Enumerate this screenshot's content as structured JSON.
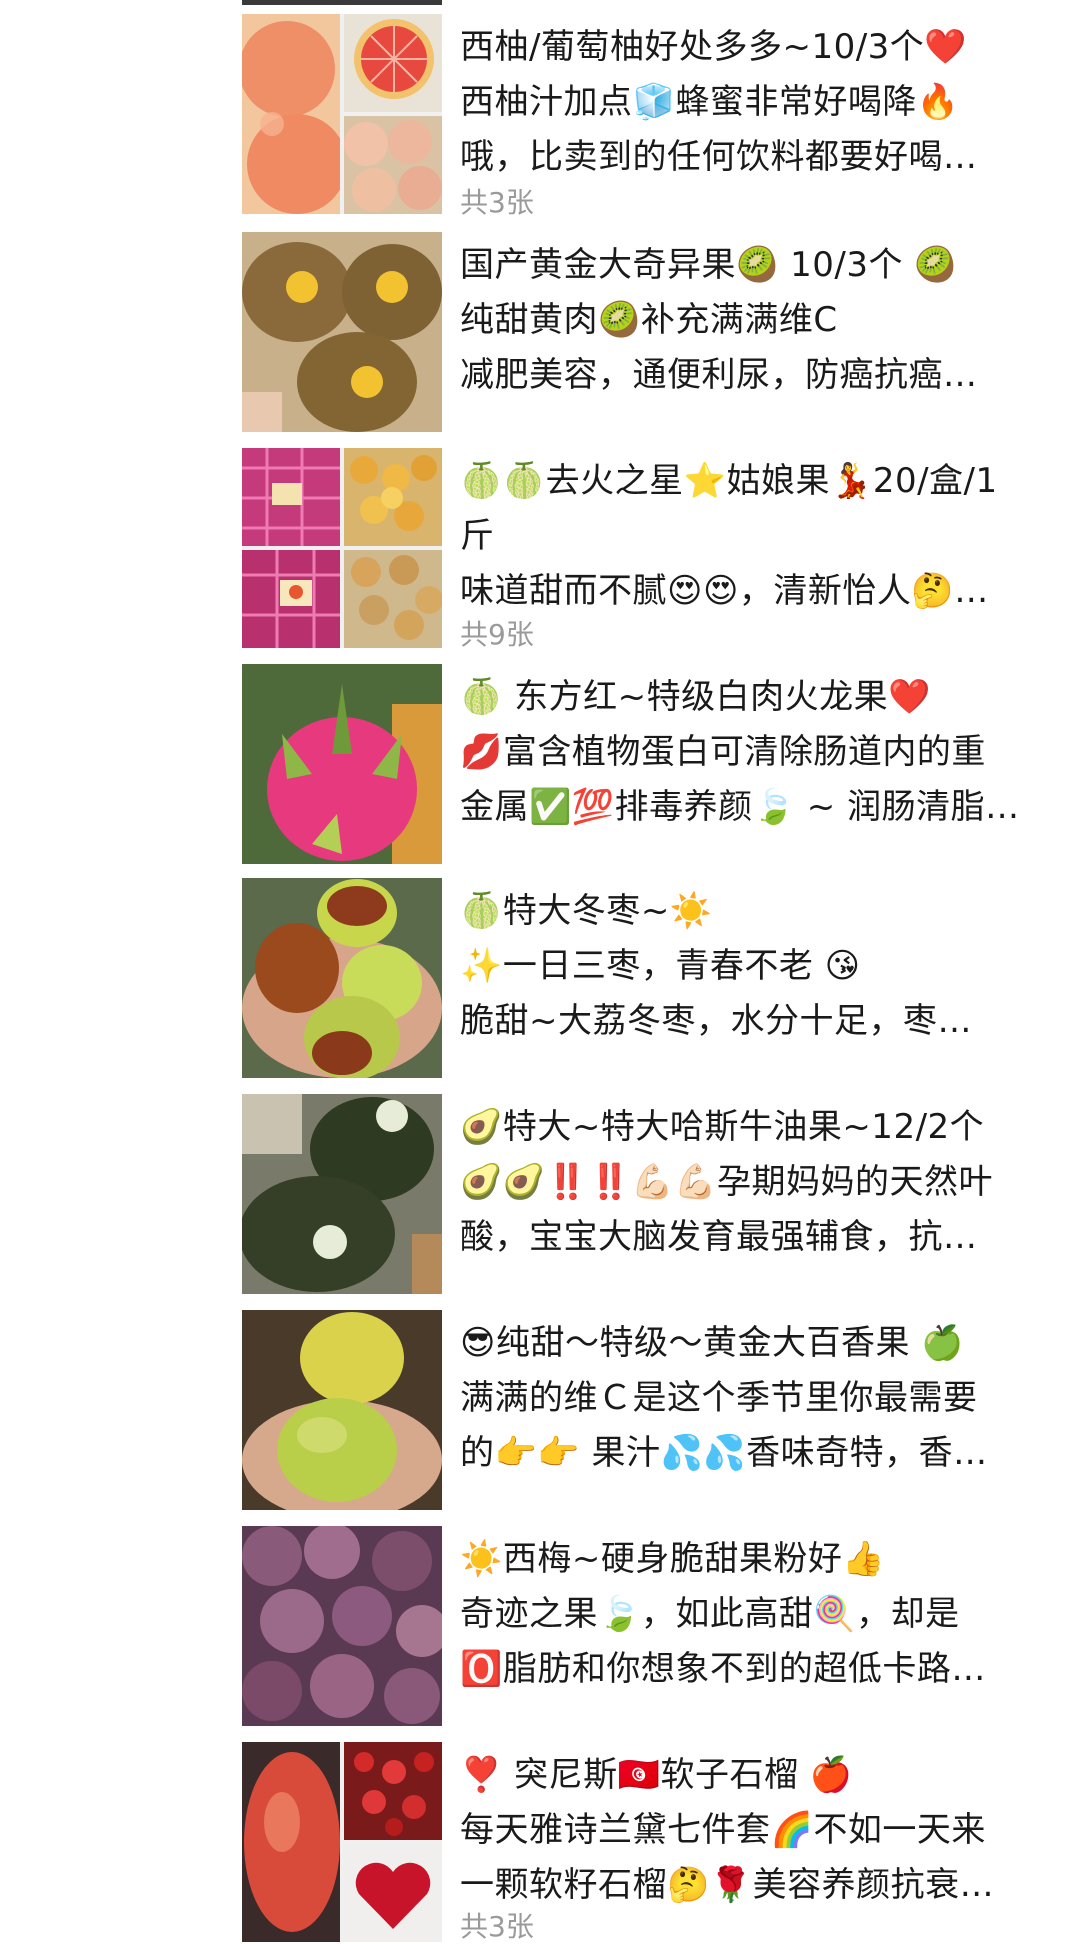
{
  "posts": [
    {
      "lines": [
        "西柚/葡萄柚好处多多~10/3个❤️",
        "西柚汁加点🧊蜂蜜非常好喝降🔥",
        "哦，比卖到的任何饮料都要好喝…"
      ],
      "count": "共3张",
      "image_icons": [
        "grapefruit-photo",
        "grapefruit-half-photo",
        "grapefruit-pile-photo"
      ]
    },
    {
      "lines": [
        "国产黄金大奇异果🥝 10/3个 🥝",
        "纯甜黄肉🥝补充满满维C",
        "减肥美容，通便利尿，防癌抗癌…"
      ],
      "count": "",
      "image_icons": [
        "kiwi-photo"
      ]
    },
    {
      "lines": [
        "🍈🍈去火之星⭐姑娘果💃20/盒/1",
        "斤",
        "味道甜而不腻😍😍，清新怡人🤔…"
      ],
      "count": "共9张",
      "image_icons": [
        "goldenberry-box-photo",
        "goldenberry-pile-photo",
        "goldenberry-box-photo-2",
        "goldenberry-husk-photo"
      ]
    },
    {
      "lines": [
        "🍈 东方红~特级白肉火龙果❤️",
        "💋富含植物蛋白可清除肠道内的重",
        "金属✅💯排毒养颜🍃 ~ 润肠清脂…"
      ],
      "count": "",
      "image_icons": [
        "dragon-fruit-photo"
      ]
    },
    {
      "lines": [
        "🍈特大冬枣~☀️",
        "✨一日三枣，青春不老 😘",
        "脆甜~大荔冬枣，水分十足，枣…"
      ],
      "count": "",
      "image_icons": [
        "jujube-photo"
      ]
    },
    {
      "lines": [
        "🥑特大~特大哈斯牛油果~12/2个",
        "🥑🥑‼️‼️💪🏻💪🏻孕期妈妈的天然叶",
        "酸，宝宝大脑发育最强辅食，抗…"
      ],
      "count": "",
      "image_icons": [
        "avocado-photo"
      ]
    },
    {
      "lines": [
        "😎纯甜～特级～黄金大百香果 🍏",
        "满满的维Ｃ是这个季节里你最需要",
        "的👉👉 果汁💦💦香味奇特，香…"
      ],
      "count": "",
      "image_icons": [
        "passion-fruit-photo"
      ]
    },
    {
      "lines": [
        "☀️西梅~硬身脆甜果粉好👍",
        "奇迹之果🍃，如此高甜🍭，却是",
        "🅾️脂肪和你想象不到的超低卡路…"
      ],
      "count": "",
      "image_icons": [
        "plum-photo"
      ]
    },
    {
      "lines": [
        "❣️ 突尼斯🇹🇳软子石榴 🍎",
        "每天雅诗兰黛七件套🌈不如一天来",
        "一颗软籽石榴🤔🌹美容养颜抗衰…"
      ],
      "count": "共3张",
      "image_icons": [
        "pomegranate-photo",
        "pomegranate-seeds-photo",
        "pomegranate-heart-photo"
      ]
    }
  ],
  "colors": {
    "background": "#ffffff",
    "text": "#1a1a1a",
    "count_text": "#9a9a9a"
  }
}
